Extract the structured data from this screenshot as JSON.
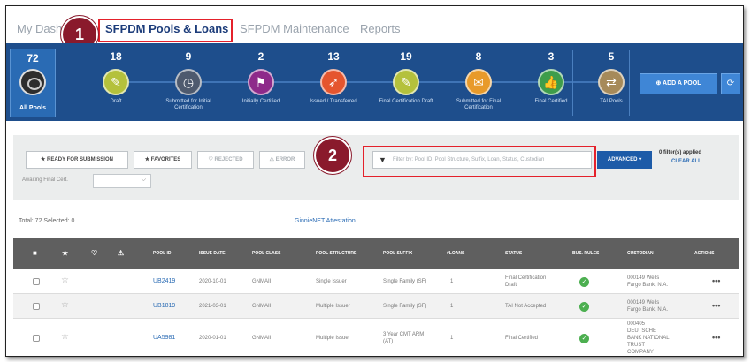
{
  "nav": {
    "tabs": [
      "My Dash",
      "SFPDM Pools & Loans",
      "SFPDM Maintenance",
      "Reports"
    ],
    "active_index": 1
  },
  "callouts": [
    "1",
    "2"
  ],
  "colors": {
    "accent": "#1e4e8c",
    "highlight": "#e4212b",
    "callout": "#8a1a2c",
    "ok": "#4caf50"
  },
  "all_pools": {
    "count": "72",
    "label": "All Pools",
    "icon": "pools-icon"
  },
  "stages": [
    {
      "count": "18",
      "label": "Draft",
      "color": "#b4c13c",
      "icon": "edit-icon",
      "glyph": "✎"
    },
    {
      "count": "9",
      "label": "Submitted for Initial Certification",
      "color": "#4e5a6e",
      "icon": "clock-icon",
      "glyph": "◷"
    },
    {
      "count": "2",
      "label": "Initially Certified",
      "color": "#8e2a8a",
      "icon": "flag-icon",
      "glyph": "⚑"
    },
    {
      "count": "13",
      "label": "Issued / Transferred",
      "color": "#e5552e",
      "icon": "rocket-icon",
      "glyph": "➶"
    },
    {
      "count": "19",
      "label": "Final Certification Draft",
      "color": "#b4c13c",
      "icon": "edit-icon",
      "glyph": "✎"
    },
    {
      "count": "8",
      "label": "Submitted for Final Certification",
      "color": "#e89a2a",
      "icon": "inbox-icon",
      "glyph": "✉"
    },
    {
      "count": "3",
      "label": "Final Certified",
      "color": "#3e9d4b",
      "icon": "thumbs-up-icon",
      "glyph": "👍"
    },
    {
      "count": "5",
      "label": "TAI Pools",
      "color": "#a68a5a",
      "icon": "transfer-icon",
      "glyph": "⇄"
    }
  ],
  "add_pool_label": "⊕ ADD A POOL",
  "refresh_glyph": "⟳",
  "filters": {
    "buttons": [
      {
        "label": "★ READY FOR SUBMISSION",
        "dim": false
      },
      {
        "label": "★ FAVORITES",
        "dim": false
      },
      {
        "label": "♡ REJECTED",
        "dim": true
      },
      {
        "label": "⚠ ERROR",
        "dim": true
      }
    ],
    "awaiting_label": "Awaiting Final Cert.",
    "awaiting_value": "",
    "search_placeholder": "Filter by: Pool ID, Pool Structure, Suffix, Loan, Status, Custodian",
    "advanced_label": "ADVANCED ▾",
    "applied_text": "0 filter(s) applied",
    "clear_all": "CLEAR ALL"
  },
  "table": {
    "totals": "Total: 72 Selected: 0",
    "ginnienet_link": "GinnieNET Attestation",
    "header_icons": [
      "■",
      "★",
      "♡",
      "⚠"
    ],
    "columns": [
      "POOL ID",
      "ISSUE DATE",
      "POOL CLASS",
      "POOL STRUCTURE",
      "POOL SUFFIX",
      "#LOANS",
      "STATUS",
      "BUS. RULES",
      "CUSTODIAN",
      "ACTIONS"
    ],
    "rows": [
      {
        "pool_id": "UB2419",
        "issue_date": "2020-10-01",
        "pool_class": "GNMAII",
        "structure": "Single Issuer",
        "suffix": [
          "Single Family (SF)"
        ],
        "loans": "1",
        "status": [
          "Final Certification",
          "Draft"
        ],
        "custodian": [
          "000149 Wells",
          "Fargo Bank, N.A."
        ]
      },
      {
        "pool_id": "UB1819",
        "issue_date": "2021-03-01",
        "pool_class": "GNMAII",
        "structure": "Multiple Issuer",
        "suffix": [
          "Single Family (SF)"
        ],
        "loans": "1",
        "status": [
          "TAI Not Accepted"
        ],
        "custodian": [
          "000149 Wells",
          "Fargo Bank, N.A."
        ]
      },
      {
        "pool_id": "UA5981",
        "issue_date": "2020-01-01",
        "pool_class": "GNMAII",
        "structure": "Multiple Issuer",
        "suffix": [
          "3 Year CMT ARM",
          "(AT)"
        ],
        "loans": "1",
        "status": [
          "Final Certified"
        ],
        "custodian": [
          "000405",
          "DEUTSCHE",
          "BANK NATIONAL",
          "TRUST",
          "COMPANY"
        ]
      }
    ],
    "ok_glyph": "✓",
    "actions_glyph": "•••",
    "empty_box": "☐",
    "star_glyph": "☆"
  }
}
